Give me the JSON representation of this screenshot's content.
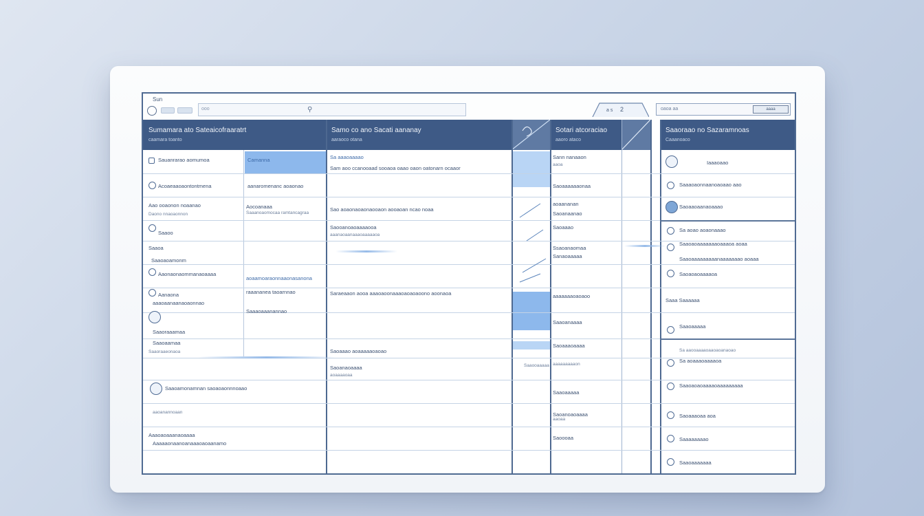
{
  "app": {
    "title": "Sun"
  },
  "colors": {
    "header": "#3e5a86",
    "highlight": "#8db8ec",
    "border": "#4f6a92",
    "background": "#c9d5e7"
  },
  "icons": [
    "menu-icon",
    "search-icon",
    "bell-icon",
    "user-icon",
    "gear-icon"
  ],
  "columns": [
    {
      "title": "Sumamara ato   Sateaicofraaratrt",
      "sub": "caamara toanto"
    },
    {
      "title": "Samo co ano    Sacati aananay",
      "sub": "aaraoco otana"
    },
    {
      "title": "Sotari atcoraciao",
      "sub": "aaoro ataco"
    },
    {
      "title": "Saaoraao no   Sazaramnoas",
      "sub": "Caaanoaco"
    }
  ],
  "col1": [
    {
      "a": "Sauanrarao aomumoa",
      "b": "Camanna"
    },
    {
      "a": "Acoaeaaoaontontmena",
      "b": "aanaromenanc aoaonao"
    },
    {
      "a": "Aao ooaonon noaanao",
      "b": "Aocoanaaa"
    },
    {
      "a": "Daono nnaoaonnon",
      "b": "Saaanoaomocaa ramtancagraa"
    },
    {
      "a": "Saaoo",
      "b": ""
    },
    {
      "a": "Saaoa",
      "b": ""
    },
    {
      "a": "Saaoaoamonm",
      "b": ""
    },
    {
      "a": "Aaonaonaommanaoaaaa",
      "b": "aoaamoaraonnaaonasanona"
    },
    {
      "a": "Aanaona",
      "b": "raaananea taoarnnao"
    },
    {
      "a": "aaaoaanaanaoaonnao",
      "b": "Saaaoaaanannao"
    },
    {
      "a": "Saaoraaamaa",
      "b": ""
    },
    {
      "a": "Saaoaamaa",
      "b": ""
    },
    {
      "a": "Saaoraaeonaoa",
      "b": ""
    },
    {
      "a": "Saaoamonamnan saoaoaonnnoaao",
      "b": ""
    },
    {
      "a": "aaoanannoaan",
      "b": ""
    },
    {
      "a": "Aaaoaoaaanaoaaaa",
      "b": ""
    },
    {
      "a": "Aaaaaonaanoanaaaoaoaanamo",
      "b": ""
    }
  ],
  "col2": [
    {
      "a": "Sa aaaoaaaao",
      "b": "Sam aoo ccanooaad sooaoa oaao oaon oatonarn ocaaor"
    },
    {
      "a": "Sao aoaonaoaonaooaon aooaoan ncao noaa",
      "b": ""
    },
    {
      "a": "Saooanoaoaaaaooa",
      "b": "aaanaoaanaaaoaaaaaoa"
    },
    {
      "a": "Saraeaaon aooa aaaoaoonaaaoaoaoaoono aoonaoa",
      "b": ""
    },
    {
      "a": "Saoaaao aoaaaaaoaoao",
      "b": ""
    },
    {
      "a": "Saoanaoaaaa",
      "b": "aoaaaaoaa"
    }
  ],
  "col3": [
    {
      "a": "Sann nanaaon",
      "b": "aaoa"
    },
    {
      "a": "Saoaaaaaaonaa",
      "b": "aoaananan"
    },
    {
      "a": "Saoanaanao",
      "b": ""
    },
    {
      "a": "Saoaaao",
      "b": "Ssaoanaomaa"
    },
    {
      "a": "Sanaoaaaaa",
      "b": "aaaaaaaoaoaoo"
    },
    {
      "a": "Saaoanaaaa",
      "b": ""
    },
    {
      "a": "Saoaaaoaaaa",
      "b": "aaaaaaaaaon"
    },
    {
      "a": "Saaoaaaaa",
      "b": ""
    },
    {
      "a": "Saoanoaoaaaa",
      "b": "aaoaa"
    },
    {
      "a": "Saoooaa",
      "b": ""
    },
    {
      "a": "Saaooaaaaa",
      "b": ""
    }
  ],
  "col4": [
    {
      "a": "Iaaaoaao"
    },
    {
      "a": "Saaaoaonnaanoaoaao aao"
    },
    {
      "a": "Saoaaoaanaoaaao"
    },
    {
      "a": "Sa aoao aoaonaaao"
    },
    {
      "a": "Saaoaoaaaaaaaoaaaoa aoaa"
    },
    {
      "a": "Saaoaaaaaaaaanaaaaaaao aoaaa"
    },
    {
      "a": "Saoaoaoaaaaoa"
    },
    {
      "a": "Saaa Saaaaaa"
    },
    {
      "a": "Saaoaaaaa"
    },
    {
      "a": "Sa aaooaaaaoaaoaoanaoao"
    },
    {
      "a": "Sa aoaaaoaaaaoa"
    },
    {
      "a": "Saaoaoaoaaaaoaaaaaaaaa"
    },
    {
      "a": "Saoaaaoaa aoa"
    },
    {
      "a": "Saaaaaaaao"
    },
    {
      "a": "Saaoaaaaaaa"
    }
  ]
}
